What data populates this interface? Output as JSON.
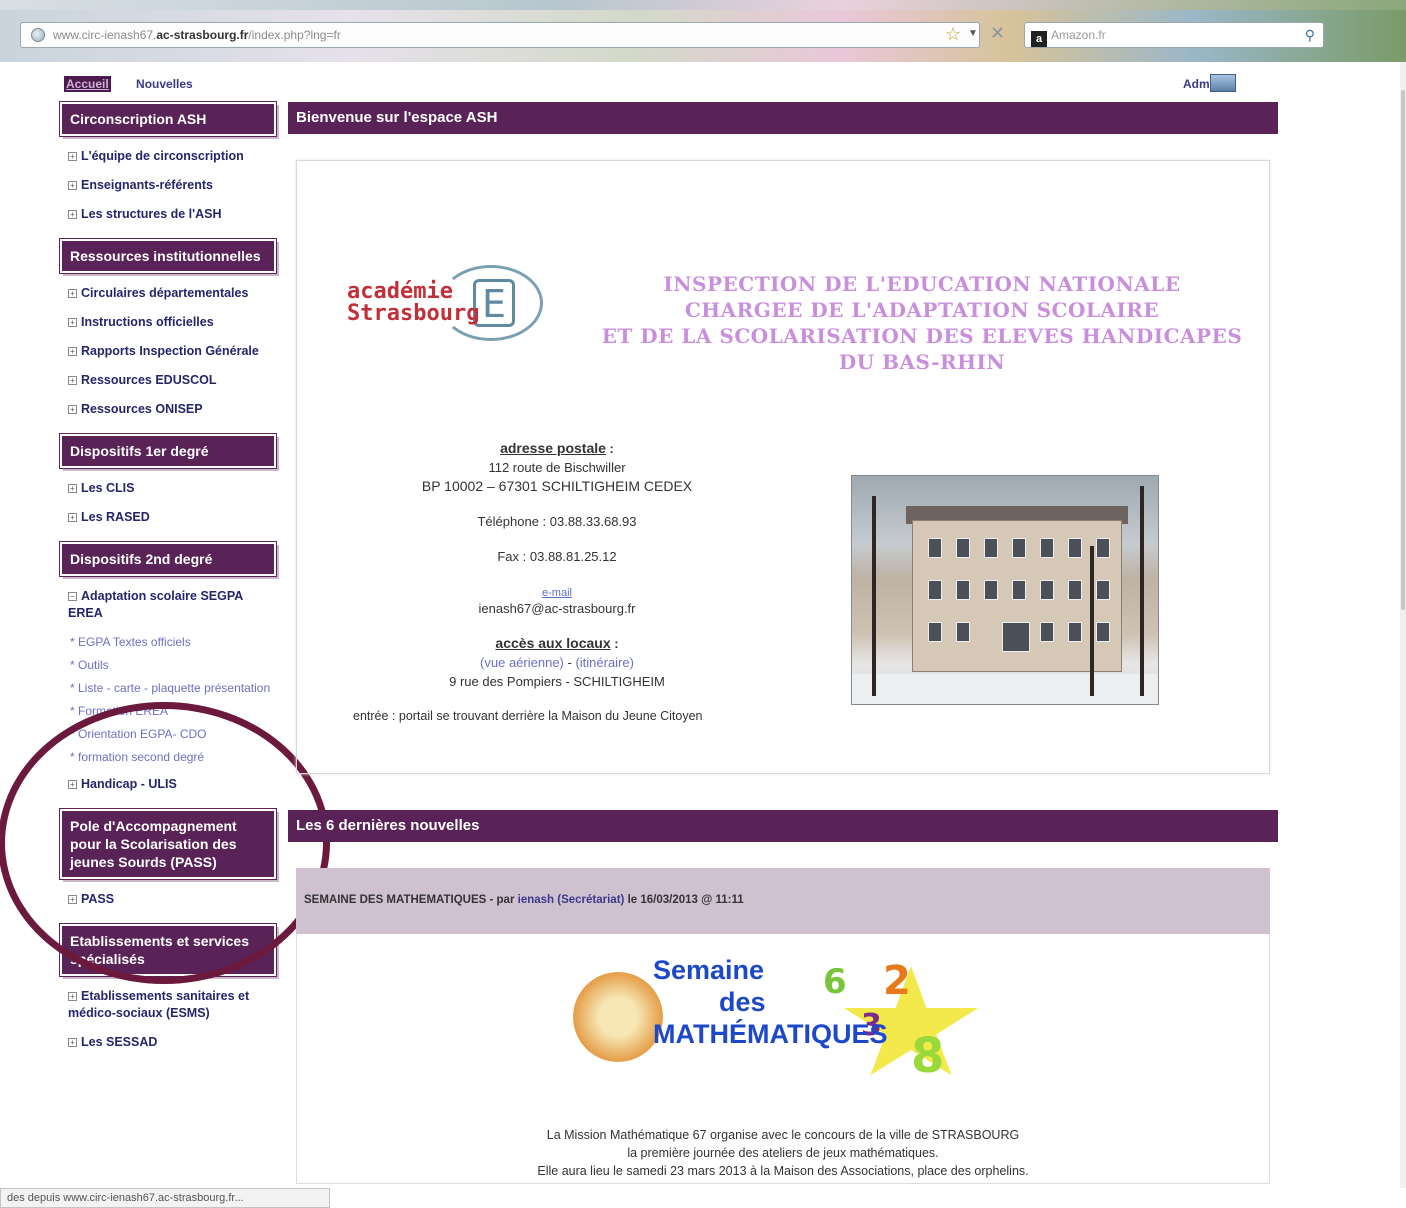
{
  "browser": {
    "url_prefix": "www.circ-ienash67.",
    "url_host": "ac-strasbourg.fr",
    "url_path": "/index.php?lng=fr",
    "search_engine_icon": "a",
    "search_placeholder": "Amazon.fr",
    "status_text": "des depuis www.circ-ienash67.ac-strasbourg.fr..."
  },
  "toplinks": {
    "home": "Accueil",
    "news": "Nouvelles",
    "admin": "Admin"
  },
  "sidebar": {
    "sections": [
      {
        "title": "Circonscription ASH",
        "items": [
          "L'équipe de circonscription",
          "Enseignants-référents",
          "Les structures de l'ASH"
        ]
      },
      {
        "title": "Ressources institutionnelles",
        "items": [
          "Circulaires départementales",
          "Instructions officielles",
          "Rapports Inspection Générale",
          "Ressources EDUSCOL",
          "Ressources ONISEP"
        ]
      },
      {
        "title": "Dispositifs 1er degré",
        "items": [
          "Les CLIS",
          "Les RASED"
        ]
      },
      {
        "title": "Dispositifs 2nd degré",
        "items": [
          "Adaptation scolaire SEGPA EREA",
          "Handicap - ULIS"
        ],
        "subitems": [
          "* EGPA Textes officiels",
          "* Outils",
          "* Liste - carte - plaquette présentation",
          "* Formation EREA",
          "* Orientation EGPA- CDO",
          "* formation second degré"
        ]
      },
      {
        "title": "Pole d'Accompagnement pour la Scolarisation des jeunes Sourds (PASS)",
        "items": [
          "PASS"
        ]
      },
      {
        "title": "Etablissements et services spécialisés",
        "items": [
          "Etablissements sanitaires et médico-sociaux (ESMS)",
          "Les SESSAD"
        ]
      }
    ]
  },
  "main": {
    "welcome_title": "Bienvenue sur l'espace ASH",
    "logo_text_1": "académie",
    "logo_text_2": "Strasbourg",
    "ien_title_lines": [
      "INSPECTION DE L'EDUCATION NATIONALE",
      "CHARGEE DE L'ADAPTATION SCOLAIRE",
      "ET DE LA SCOLARISATION DES ELEVES HANDICAPES",
      "DU BAS-RHIN"
    ],
    "contact": {
      "postal_label": "adresse postale",
      "postal_suffix": " :",
      "address_1": "112 route de Bischwiller",
      "address_2": "BP 10002 – 67301 SCHILTIGHEIM CEDEX",
      "phone": "Téléphone : 03.88.33.68.93",
      "fax": "Fax : 03.88.81.25.12",
      "email_label": "e-mail",
      "email": "ienash67@ac-strasbourg.fr",
      "access_label": "accès aux locaux",
      "access_suffix": " :",
      "aerial_link": "(vue aérienne)",
      "separator": " - ",
      "route_link": "(itinéraire)",
      "access_address": "9 rue des Pompiers - SCHILTIGHEIM",
      "entrance": "entrée :  portail se trouvant derrière la Maison du Jeune Citoyen"
    },
    "news_title": "Les 6 dernières nouvelles",
    "news_item": {
      "title": "SEMAINE DES MATHEMATIQUES",
      "by": " - par ",
      "author": "ienash (Secrétariat)",
      "date": " le 16/03/2013 @ 11:11",
      "image_lines": [
        "Semaine",
        "des",
        "MATHÉMATIQUES"
      ],
      "body_lines": [
        "La Mission Mathématique 67 organise avec le concours de la ville de STRASBOURG",
        "la première journée des ateliers de jeux mathématiques.",
        "Elle aura lieu le samedi 23 mars 2013 à la Maison des Associations, place des orphelins."
      ]
    }
  },
  "colors": {
    "section_header": "#5a2357",
    "annotation_circle": "#6b1a3d",
    "title_pink": "#c98fdc"
  }
}
